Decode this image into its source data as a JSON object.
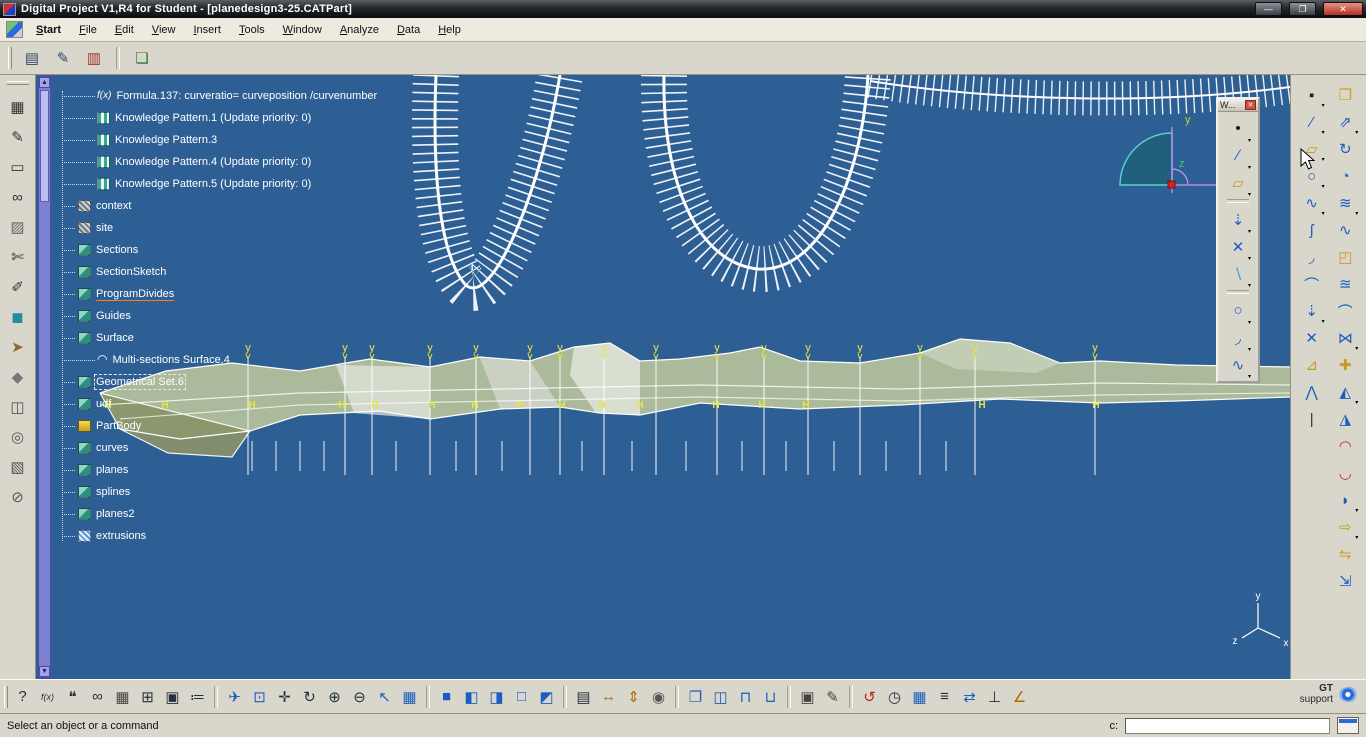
{
  "window": {
    "title": "Digital Project V1,R4 for Student - [planedesign3-25.CATPart]",
    "controls": {
      "minimize": "—",
      "maximize": "❐",
      "close": "✕"
    }
  },
  "menu": {
    "items": [
      "Start",
      "File",
      "Edit",
      "View",
      "Insert",
      "Tools",
      "Window",
      "Analyze",
      "Data",
      "Help"
    ]
  },
  "top_toolbar": {
    "items": [
      {
        "name": "workbench-window-icon",
        "glyph": "▤",
        "color": "#334a66"
      },
      {
        "name": "edit-window-icon",
        "glyph": "✎",
        "color": "#334a66"
      },
      {
        "name": "delete-window-icon",
        "glyph": "▥",
        "color": "#a23224"
      },
      {
        "sep": true
      },
      {
        "name": "knowledge-clip-icon",
        "glyph": "❏",
        "color": "#2a7a2a"
      }
    ]
  },
  "left_toolbar": {
    "items": [
      {
        "name": "select-grid-icon",
        "glyph": "▦",
        "color": "#333"
      },
      {
        "name": "pen-icon",
        "glyph": "✎",
        "color": "#333"
      },
      {
        "name": "frame-icon",
        "glyph": "▭",
        "color": "#333"
      },
      {
        "name": "goggles-icon",
        "glyph": "∞",
        "color": "#333"
      },
      {
        "name": "paint-icon",
        "glyph": "▨",
        "color": "#666"
      },
      {
        "name": "scissors-icon",
        "glyph": "✄",
        "color": "#333"
      },
      {
        "name": "brush-icon",
        "glyph": "✐",
        "color": "#333"
      },
      {
        "name": "teal-cube-icon",
        "glyph": "◼",
        "color": "#1f8f9f"
      },
      {
        "name": "hand-icon",
        "glyph": "➤",
        "color": "#8a6a2a"
      },
      {
        "name": "gem-icon",
        "glyph": "◆",
        "color": "#777"
      },
      {
        "name": "mirror-icon",
        "glyph": "◫",
        "color": "#555"
      },
      {
        "name": "cylinder-icon",
        "glyph": "◎",
        "color": "#555"
      },
      {
        "name": "hatch-icon",
        "glyph": "▧",
        "color": "#555"
      },
      {
        "name": "slash-circle-icon",
        "glyph": "⊘",
        "color": "#555"
      }
    ]
  },
  "right_toolbar": {
    "col1": [
      {
        "name": "point-tool-icon",
        "glyph": "▪",
        "color": "#222",
        "arrow": true
      },
      {
        "name": "line-tool-icon",
        "glyph": "∕",
        "color": "#1a5fbf",
        "arrow": true
      },
      {
        "name": "plane-tool-icon",
        "glyph": "▱",
        "color": "#c79a1e",
        "arrow": true
      },
      {
        "name": "circle-tool-icon",
        "glyph": "○",
        "color": "#1a5fbf",
        "arrow": true
      },
      {
        "name": "spline-tool-icon",
        "glyph": "∿",
        "color": "#1a5fbf",
        "arrow": true
      },
      {
        "name": "helix-tool-icon",
        "glyph": "ʃ",
        "color": "#1a5fbf"
      },
      {
        "name": "corner-tool-icon",
        "glyph": "◞",
        "color": "#1a5fbf"
      },
      {
        "name": "connect-curve-icon",
        "glyph": "⌒",
        "color": "#1a5fbf"
      },
      {
        "name": "project-tool-icon",
        "glyph": "⇣",
        "color": "#1a5fbf",
        "arrow": true
      },
      {
        "name": "intersect-tool-icon",
        "glyph": "✕",
        "color": "#1a5fbf"
      },
      {
        "name": "law-tool-icon",
        "glyph": "⊿",
        "color": "#c79a1e"
      },
      {
        "name": "polyline-tool-icon",
        "glyph": "⋀",
        "color": "#1a5fbf"
      },
      {
        "name": "axis-line-icon",
        "glyph": "|",
        "color": "#333"
      }
    ],
    "col2": [
      {
        "name": "catalog-icon",
        "glyph": "❒",
        "color": "#d99b1a"
      },
      {
        "name": "extrude-icon",
        "glyph": "⇗",
        "color": "#1a5fbf",
        "arrow": true
      },
      {
        "name": "revolve-icon",
        "glyph": "↻",
        "color": "#1a5fbf"
      },
      {
        "name": "sphere-icon",
        "glyph": "◔",
        "color": "#1a5fbf"
      },
      {
        "name": "offset-surface-icon",
        "glyph": "≋",
        "color": "#1a5fbf",
        "arrow": true
      },
      {
        "name": "sweep-icon",
        "glyph": "∿",
        "color": "#1a5fbf"
      },
      {
        "name": "fill-icon",
        "glyph": "◰",
        "color": "#c79a1e"
      },
      {
        "name": "loft-icon",
        "glyph": "≊",
        "color": "#1a5fbf"
      },
      {
        "name": "blend-icon",
        "glyph": "⌒",
        "color": "#1a5fbf"
      },
      {
        "name": "join-icon",
        "glyph": "⋈",
        "color": "#1a5fbf",
        "arrow": true
      },
      {
        "name": "healing-icon",
        "glyph": "✚",
        "color": "#c79a1e"
      },
      {
        "name": "split-icon",
        "glyph": "◭",
        "color": "#1a5fbf",
        "arrow": true
      },
      {
        "name": "trim-icon",
        "glyph": "◮",
        "color": "#1a5fbf"
      },
      {
        "name": "boundary-icon",
        "glyph": "◠",
        "color": "#b2391a"
      },
      {
        "name": "extract-icon",
        "glyph": "◡",
        "color": "#b2391a"
      },
      {
        "name": "fillet-icon",
        "glyph": "◗",
        "color": "#1a5fbf",
        "arrow": true
      },
      {
        "name": "translate-icon",
        "glyph": "⇨",
        "color": "#c79a1e",
        "arrow": true
      },
      {
        "name": "symmetry-icon",
        "glyph": "⇋",
        "color": "#c79a1e"
      },
      {
        "name": "scale-icon",
        "glyph": "⇲",
        "color": "#1a5fbf"
      }
    ]
  },
  "palette": {
    "title": "W...",
    "close_glyph": "✕",
    "items": [
      {
        "name": "point-icon",
        "glyph": "•",
        "color": "#111",
        "arrow": true
      },
      {
        "name": "line-icon",
        "glyph": "∕",
        "color": "#1a5fbf",
        "arrow": true
      },
      {
        "name": "plane-icon",
        "glyph": "▱",
        "color": "#c79a1e",
        "arrow": true
      },
      {
        "sep": true
      },
      {
        "name": "projection-icon",
        "glyph": "⇣",
        "color": "#1a5fbf",
        "arrow": true
      },
      {
        "name": "intersection-icon",
        "glyph": "✕",
        "color": "#1a5fbf",
        "arrow": true
      },
      {
        "name": "reflect-line-icon",
        "glyph": "∖",
        "color": "#38a0d0",
        "arrow": true
      },
      {
        "sep": true
      },
      {
        "name": "circle-icon",
        "glyph": "○",
        "color": "#1a5fbf",
        "arrow": true
      },
      {
        "name": "corner-icon",
        "glyph": "◞",
        "color": "#1a5fbf",
        "arrow": true
      },
      {
        "name": "spline-icon",
        "glyph": "∿",
        "color": "#1a5fbf",
        "arrow": true
      }
    ]
  },
  "bottom_toolbar": {
    "items": [
      {
        "name": "whats-this-icon",
        "glyph": "?"
      },
      {
        "name": "formula-icon",
        "glyph": "f(x)",
        "small": true
      },
      {
        "name": "comment-icon",
        "glyph": "❝"
      },
      {
        "name": "link-icon",
        "glyph": "∞"
      },
      {
        "name": "table-icon",
        "glyph": "▦",
        "color": "#444"
      },
      {
        "name": "design-table-icon",
        "glyph": "⊞"
      },
      {
        "name": "lock-icon",
        "glyph": "▣"
      },
      {
        "name": "knowledge-icon",
        "glyph": "≔"
      },
      {
        "sep": true
      },
      {
        "name": "fly-mode-icon",
        "glyph": "✈",
        "color": "#1a5fbf"
      },
      {
        "name": "fit-all-icon",
        "glyph": "⊡",
        "color": "#1a5fbf"
      },
      {
        "name": "pan-icon",
        "glyph": "✛"
      },
      {
        "name": "rotate-icon",
        "glyph": "↻"
      },
      {
        "name": "zoom-in-icon",
        "glyph": "⊕"
      },
      {
        "name": "zoom-out-icon",
        "glyph": "⊖"
      },
      {
        "name": "normal-view-icon",
        "glyph": "↖",
        "color": "#1a5fbf"
      },
      {
        "name": "multi-view-icon",
        "glyph": "▦",
        "color": "#1a5fbf"
      },
      {
        "sep": true
      },
      {
        "name": "shaded-view-icon",
        "glyph": "■",
        "color": "#1a5fbf"
      },
      {
        "name": "shading-edges-icon",
        "glyph": "◧",
        "color": "#1a5fbf"
      },
      {
        "name": "hidden-edges-icon",
        "glyph": "◨",
        "color": "#1a5fbf"
      },
      {
        "name": "wireframe-icon",
        "glyph": "□",
        "color": "#1a5fbf"
      },
      {
        "name": "render-style-icon",
        "glyph": "◩",
        "color": "#1a5fbf"
      },
      {
        "sep": true
      },
      {
        "name": "print-capture-icon",
        "glyph": "▤"
      },
      {
        "name": "measure-between-icon",
        "glyph": "↔",
        "color": "#b26a00"
      },
      {
        "name": "measure-item-icon",
        "glyph": "⇕",
        "color": "#b26a00"
      },
      {
        "name": "mass-properties-icon",
        "glyph": "◉",
        "color": "#555"
      },
      {
        "sep": true
      },
      {
        "name": "iso-view-icon",
        "glyph": "❐",
        "color": "#1a5fbf"
      },
      {
        "name": "front-view-icon",
        "glyph": "◫",
        "color": "#1a5fbf"
      },
      {
        "name": "top-view-icon",
        "glyph": "⊓",
        "color": "#1a5fbf"
      },
      {
        "name": "side-view-icon",
        "glyph": "⊔",
        "color": "#1a5fbf"
      },
      {
        "sep": true
      },
      {
        "name": "capture-icon",
        "glyph": "▣",
        "color": "#444"
      },
      {
        "name": "sketch-tracer-icon",
        "glyph": "✎",
        "color": "#444"
      },
      {
        "sep": true
      },
      {
        "name": "update-icon",
        "glyph": "↺",
        "color": "#b22a1a"
      },
      {
        "name": "history-icon",
        "glyph": "◷"
      },
      {
        "name": "grid-icon",
        "glyph": "▦",
        "color": "#1a5fbf"
      },
      {
        "name": "structure-icon",
        "glyph": "≡"
      },
      {
        "name": "swap-space-icon",
        "glyph": "⇄",
        "color": "#1a5fbf"
      },
      {
        "name": "axis-system-icon",
        "glyph": "⊥"
      },
      {
        "name": "snap-angle-icon",
        "glyph": "∠",
        "color": "#b26a00"
      }
    ],
    "gt": {
      "line1": "GT",
      "line2": "support"
    }
  },
  "status_bar": {
    "message": "Select an object or a command",
    "power_input_label": "c:"
  },
  "tree": {
    "items": [
      {
        "label": "Formula.137: curveratio= curveposition /curvenumber",
        "level": 1,
        "icon": "fx"
      },
      {
        "label": "Knowledge Pattern.1 (Update priority: 0)",
        "level": 1,
        "icon": "kp"
      },
      {
        "label": "Knowledge Pattern.3",
        "level": 1,
        "icon": "kp"
      },
      {
        "label": "Knowledge Pattern.4 (Update priority: 0)",
        "level": 1,
        "icon": "kp"
      },
      {
        "label": "Knowledge Pattern.5 (Update priority: 0)",
        "level": 1,
        "icon": "kp"
      },
      {
        "label": "context",
        "level": 0,
        "icon": "gray"
      },
      {
        "label": "site",
        "level": 0,
        "icon": "gray"
      },
      {
        "label": "Sections",
        "level": 0,
        "icon": "set"
      },
      {
        "label": "SectionSketch",
        "level": 0,
        "icon": "set"
      },
      {
        "label": "ProgramDivides",
        "level": 0,
        "icon": "set",
        "selected": true
      },
      {
        "label": "Guides",
        "level": 0,
        "icon": "set"
      },
      {
        "label": "Surface",
        "level": 0,
        "icon": "set"
      },
      {
        "label": "Multi-sections Surface.4",
        "level": 1,
        "icon": "surface"
      },
      {
        "label": "Geometrical Set.6",
        "level": 0,
        "icon": "set",
        "boxed": true
      },
      {
        "label": "udf",
        "level": 0,
        "icon": "set"
      },
      {
        "label": "PartBody",
        "level": 0,
        "icon": "body"
      },
      {
        "label": "curves",
        "level": 0,
        "icon": "set"
      },
      {
        "label": "planes",
        "level": 0,
        "icon": "set"
      },
      {
        "label": "splines",
        "level": 0,
        "icon": "set"
      },
      {
        "label": "planes2",
        "level": 0,
        "icon": "set"
      },
      {
        "label": "extrusions",
        "level": 0,
        "icon": "ext"
      }
    ]
  },
  "viewport": {
    "background": "#2e5f94",
    "marker_color": "#e8e83a",
    "curve_color": "#ffffff",
    "surface_fill": "#bcc79b",
    "section_label": "y",
    "h_label": "H",
    "section_xs": [
      212,
      309,
      336,
      394,
      440,
      494,
      524,
      568,
      620,
      681,
      728,
      772,
      824,
      884,
      939,
      1059
    ],
    "h_xs": [
      72,
      129,
      216,
      306,
      339,
      396,
      439,
      484,
      526,
      566,
      604,
      680,
      726,
      770,
      946,
      1060
    ],
    "tick_xs": [
      216,
      240,
      264,
      288,
      309,
      336,
      360,
      394,
      420,
      440,
      466,
      494,
      524,
      546,
      568,
      596,
      620,
      650,
      681,
      706,
      728,
      750,
      772,
      798,
      824,
      850,
      884,
      910,
      939
    ],
    "compass": {
      "y": "y",
      "z": "z"
    },
    "triad": {
      "x": "x",
      "y": "y",
      "z": "z"
    }
  }
}
